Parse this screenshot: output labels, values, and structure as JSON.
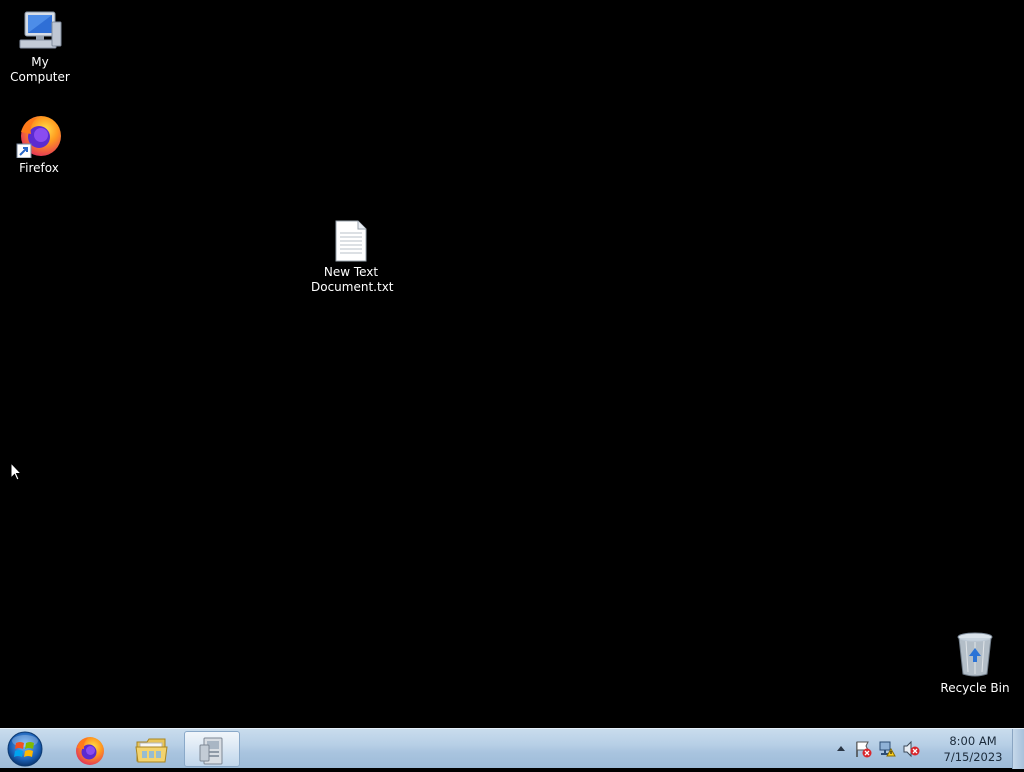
{
  "desktop": {
    "icons": [
      {
        "label": "My Computer",
        "icon": "computer-icon"
      },
      {
        "label": "Firefox",
        "icon": "firefox-icon"
      },
      {
        "label": "New Text\nDocument.txt",
        "icon": "text-file-icon"
      },
      {
        "label": "Recycle Bin",
        "icon": "recycle-bin-icon"
      }
    ]
  },
  "taskbar": {
    "start": {
      "icon": "windows-logo-icon"
    },
    "pinned": [
      {
        "icon": "firefox-icon"
      },
      {
        "icon": "folder-icon"
      },
      {
        "icon": "app-icon"
      }
    ],
    "clock": {
      "time": "8:00 AM",
      "date": "7/15/2023"
    }
  },
  "colors": {
    "desktop_bg": "#000000",
    "taskbar": "#b7cfe6"
  }
}
